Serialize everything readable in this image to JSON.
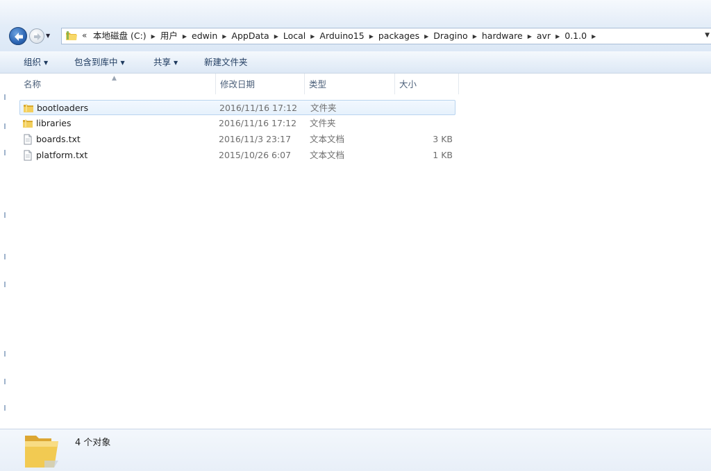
{
  "address": {
    "overflow_label": "«",
    "crumbs": [
      "本地磁盘 (C:)",
      "用户",
      "edwin",
      "AppData",
      "Local",
      "Arduino15",
      "packages",
      "Dragino",
      "hardware",
      "avr",
      "0.1.0"
    ]
  },
  "commands": {
    "organize": "组织",
    "include_in_library": "包含到库中",
    "share": "共享",
    "new_folder": "新建文件夹"
  },
  "columns": {
    "name": "名称",
    "date_modified": "修改日期",
    "type": "类型",
    "size": "大小"
  },
  "files": [
    {
      "icon": "folder-icon",
      "name": "bootloaders",
      "date": "2016/11/16 17:12",
      "type": "文件夹",
      "size": "",
      "selected": true
    },
    {
      "icon": "folder-icon",
      "name": "libraries",
      "date": "2016/11/16 17:12",
      "type": "文件夹",
      "size": "",
      "selected": false
    },
    {
      "icon": "text-file-icon",
      "name": "boards.txt",
      "date": "2016/11/3 23:17",
      "type": "文本文档",
      "size": "3 KB",
      "selected": false
    },
    {
      "icon": "text-file-icon",
      "name": "platform.txt",
      "date": "2015/10/26 6:07",
      "type": "文本文档",
      "size": "1 KB",
      "selected": false
    }
  ],
  "status": {
    "item_count": "4 个对象"
  },
  "colors": {
    "folder": "#f0c545",
    "selection_bg": "#e6f1fc",
    "selection_border": "#b9d4ef",
    "command_text": "#1e3a5f",
    "back_button": "#2d66b4"
  }
}
